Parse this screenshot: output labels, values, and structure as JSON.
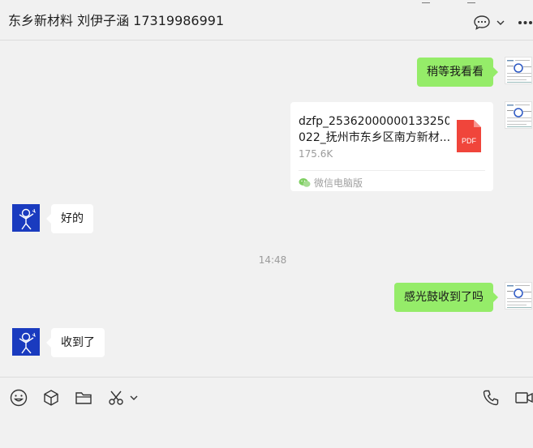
{
  "header": {
    "title": "东乡新材料 刘伊子涵 17319986991",
    "icons": [
      "chat-bubble-icon",
      "chevron-down-icon",
      "more-icon"
    ]
  },
  "messages": [
    {
      "side": "right",
      "type": "text",
      "text": "稍等我看看"
    },
    {
      "side": "right",
      "type": "file",
      "file_name_line1": "dzfp_25362000000133250",
      "file_name_line2": "022_抚州市东乡区南方新材...",
      "file_size": "175.6K",
      "file_badge": "PDF",
      "source": "微信电脑版"
    },
    {
      "side": "left",
      "type": "text",
      "text": "好的"
    },
    {
      "side": "center",
      "type": "time",
      "text": "14:48"
    },
    {
      "side": "right",
      "type": "text",
      "text": "感光鼓收到了吗"
    },
    {
      "side": "left",
      "type": "text",
      "text": "收到了"
    }
  ],
  "composer": {
    "tools": [
      "emoji-icon",
      "cube-icon",
      "folder-icon",
      "scissors-icon",
      "chevron-down-icon",
      "phone-icon",
      "video-icon"
    ]
  },
  "colors": {
    "sent_bubble": "#95ec69",
    "received_bubble": "#ffffff",
    "avatar_blue": "#1a3bbf",
    "pdf_red": "#f0453b",
    "background": "#f1f1f1"
  }
}
